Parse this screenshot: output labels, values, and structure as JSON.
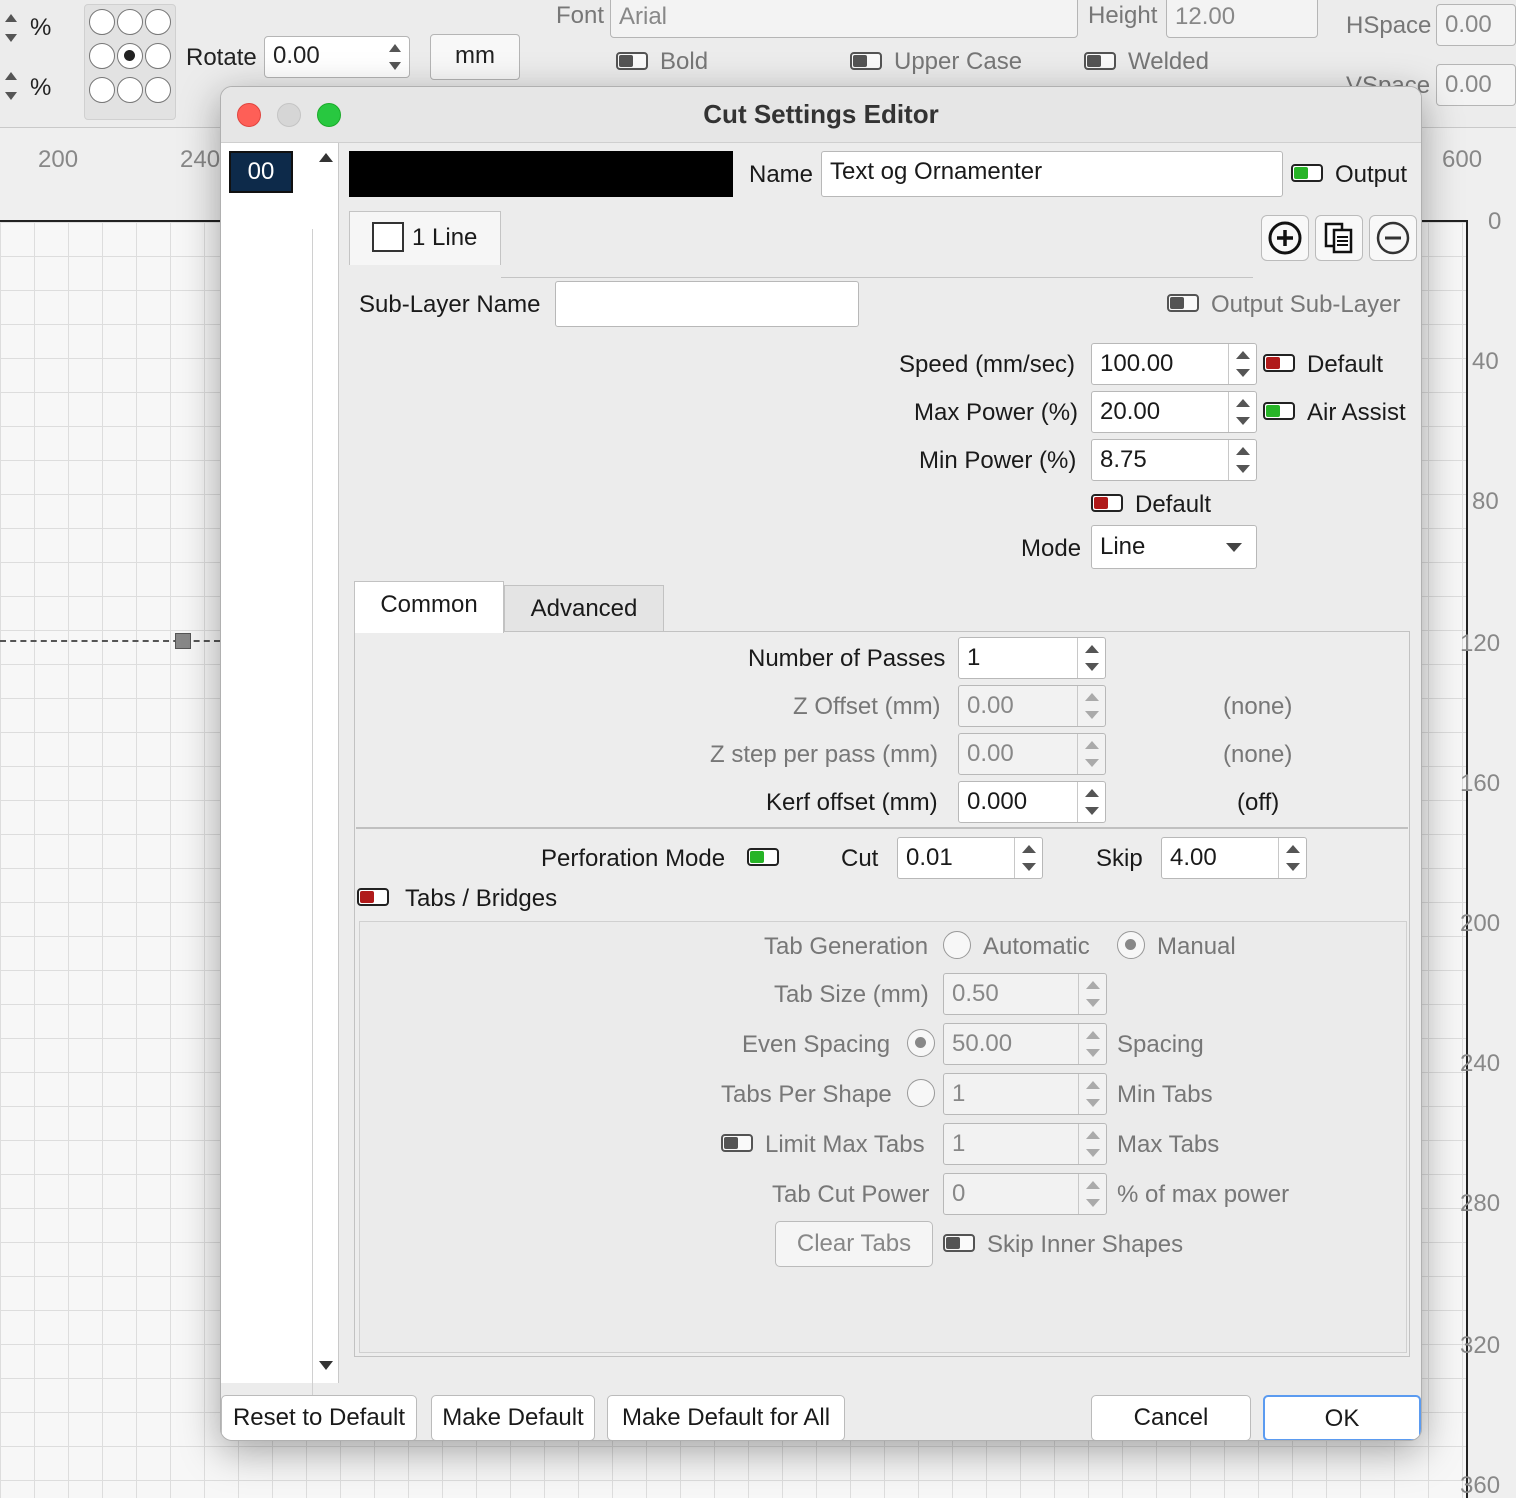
{
  "toolbar": {
    "pct1": "%",
    "pct2": "%",
    "rotate_label": "Rotate",
    "rotate_value": "0.00",
    "units_button": "mm",
    "font_label": "Font",
    "font_value": "Arial",
    "height_label": "Height",
    "height_value": "12.00",
    "hspace_label": "HSpace",
    "hspace_value": "0.00",
    "vspace_label": "VSpace",
    "vspace_value": "0.00",
    "bold_label": "Bold",
    "upper_case_label": "Upper Case",
    "welded_label": "Welded"
  },
  "ruler": {
    "top": [
      "200",
      "240",
      "600"
    ],
    "right": [
      "0",
      "40",
      "80",
      "120",
      "160",
      "200",
      "240",
      "280",
      "320",
      "360"
    ]
  },
  "dialog": {
    "title": "Cut Settings Editor",
    "layer_list": [
      "00"
    ],
    "layer_color": "#000000",
    "name_label": "Name",
    "name_value": "Text og Ornamenter",
    "output_label": "Output",
    "sub_tab_label": "1 Line",
    "sub_layer_name_label": "Sub-Layer Name",
    "sub_layer_name_value": "",
    "output_sub_layer_label": "Output Sub-Layer",
    "speed_label": "Speed (mm/sec)",
    "speed_value": "100.00",
    "speed_default_label": "Default",
    "max_power_label": "Max Power (%)",
    "max_power_value": "20.00",
    "air_assist_label": "Air Assist",
    "min_power_label": "Min Power (%)",
    "min_power_value": "8.75",
    "power_default_label": "Default",
    "mode_label": "Mode",
    "mode_value": "Line",
    "tabs": [
      "Common",
      "Advanced"
    ],
    "common": {
      "passes_label": "Number of Passes",
      "passes_value": "1",
      "z_offset_label": "Z Offset (mm)",
      "z_offset_value": "0.00",
      "z_offset_note": "(none)",
      "z_step_label": "Z step per pass (mm)",
      "z_step_value": "0.00",
      "z_step_note": "(none)",
      "kerf_label": "Kerf offset (mm)",
      "kerf_value": "0.000",
      "kerf_note": "(off)",
      "perforation_label": "Perforation Mode",
      "cut_label": "Cut",
      "cut_value": "0.01",
      "skip_label": "Skip",
      "skip_value": "4.00",
      "tabs_bridges_label": "Tabs / Bridges",
      "tab_generation_label": "Tab Generation",
      "automatic_label": "Automatic",
      "manual_label": "Manual",
      "tab_size_label": "Tab Size (mm)",
      "tab_size_value": "0.50",
      "even_spacing_label": "Even Spacing",
      "even_spacing_value": "50.00",
      "spacing_label": "Spacing",
      "tabs_per_shape_label": "Tabs Per Shape",
      "tabs_per_shape_value": "1",
      "min_tabs_label": "Min Tabs",
      "limit_max_tabs_label": "Limit Max Tabs",
      "max_tabs_value": "1",
      "max_tabs_label": "Max Tabs",
      "tab_cut_power_label": "Tab Cut Power",
      "tab_cut_power_value": "0",
      "tab_cut_power_unit": "% of max power",
      "clear_tabs_label": "Clear Tabs",
      "skip_inner_label": "Skip Inner Shapes"
    },
    "buttons": {
      "reset": "Reset to Default",
      "make_default": "Make Default",
      "make_default_all": "Make Default for All",
      "cancel": "Cancel",
      "ok": "OK"
    }
  }
}
